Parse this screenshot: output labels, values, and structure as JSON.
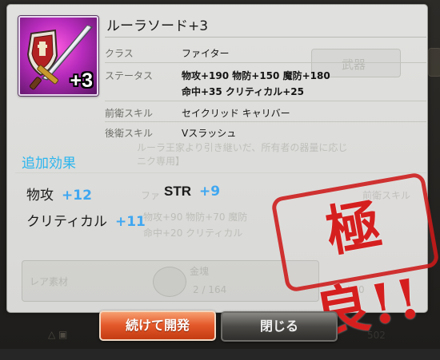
{
  "item": {
    "name": "ルーラソード+3",
    "icon": "sword-and-shield-icon",
    "plus_badge": "+3"
  },
  "details": {
    "class_label": "クラス",
    "class_value": "ファイター",
    "status_label": "ステータス",
    "status_line1": "物攻+190  物防+150  魔防+180",
    "status_line2": "命中+35  クリティカル+25",
    "front_skill_label": "前衛スキル",
    "front_skill_value": "セイクリッド キャリバー",
    "back_skill_label": "後衛スキル",
    "back_skill_value": "Vスラッシュ"
  },
  "extra": {
    "title": "追加効果",
    "effects": [
      {
        "name": "物攻",
        "value": "+12"
      },
      {
        "name": "STR",
        "value": "+9"
      },
      {
        "name": "クリティカル",
        "value": "+11"
      }
    ]
  },
  "stamp": "極良!!",
  "buttons": {
    "continue": "続けて開発",
    "close": "閉じる"
  },
  "background_text": {
    "weapon_tab": "武器",
    "desc_line1": "ルーラ王家より引き継いだ、所有者の器量に応じ",
    "desc_line2": "ニク専用】",
    "class_ghost": "ファ",
    "front_skill_ghost": "前衛スキル",
    "stat_ghost1": "物攻+90  物防+70  魔防",
    "stat_ghost2": "命中+20  クリティカル",
    "rare_material": "レア素材",
    "gold_label": "金塊",
    "gold_count": "2 / 164",
    "other_count": "1 / 10",
    "bottom_number": "502"
  },
  "colors": {
    "accent_blue": "#2bb5ee",
    "bonus_blue": "#3fa7f1",
    "stamp_red": "#d51f1f",
    "button_orange": "#e4592b"
  }
}
